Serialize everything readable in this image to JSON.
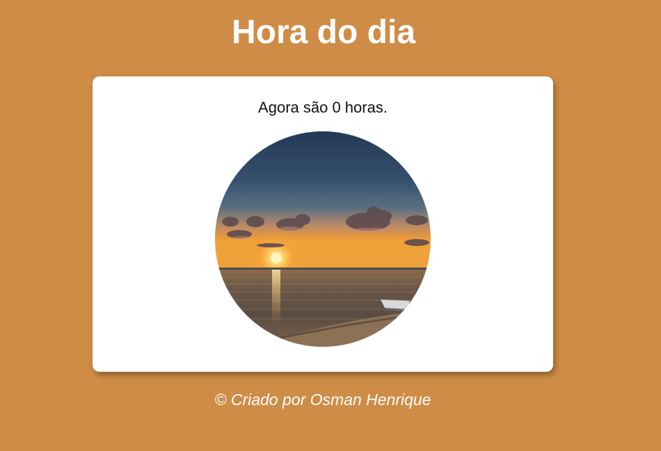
{
  "page": {
    "title": "Hora do dia",
    "background_color": "#CF8C46"
  },
  "card": {
    "message": "Agora são 0 horas.",
    "image": {
      "icon": "sunset-over-sea-photo"
    }
  },
  "footer": {
    "text": "© Criado por Osman Henrique"
  }
}
